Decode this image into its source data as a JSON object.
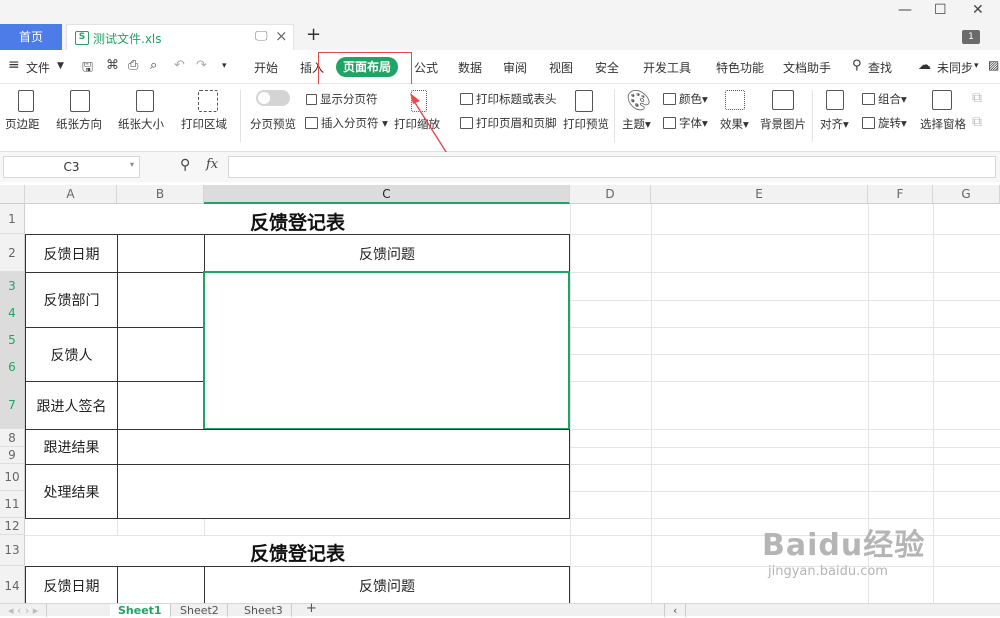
{
  "tabs": {
    "home": "首页",
    "file": "测试文件.xls",
    "new": "+"
  },
  "window": {
    "minimize": "—",
    "maximize": "☐",
    "close": "✕",
    "badge": "1"
  },
  "menu": {
    "file": "文件",
    "items": [
      "开始",
      "插入",
      "页面布局",
      "公式",
      "数据",
      "审阅",
      "视图",
      "安全",
      "开发工具",
      "特色功能",
      "文档助手"
    ],
    "active": "页面布局",
    "search": "查找",
    "sync": "未同步"
  },
  "ribbon": {
    "margins": "页边距",
    "orientation": "纸张方向",
    "size": "纸张大小",
    "print_area": "打印区域",
    "page_preview": "分页预览",
    "show_breaks": "显示分页符",
    "insert_break": "插入分页符",
    "print_scale": "打印缩放",
    "print_titles": "打印标题或表头",
    "header_footer": "打印页眉和页脚",
    "print_preview": "打印预览",
    "theme": "主题",
    "colors": "颜色",
    "fonts": "字体",
    "effects": "效果",
    "background": "背景图片",
    "align": "对齐",
    "group": "组合",
    "rotate": "旋转",
    "selection_pane": "选择窗格"
  },
  "formula": {
    "cell_ref": "C3",
    "fx": "fx",
    "value": ""
  },
  "columns": [
    "A",
    "B",
    "C",
    "D",
    "E",
    "F",
    "G"
  ],
  "rows": [
    "1",
    "2",
    "3",
    "4",
    "5",
    "6",
    "7",
    "8",
    "9",
    "10",
    "11",
    "12",
    "13",
    "14"
  ],
  "form": {
    "title": "反馈登记表",
    "feedback_date": "反馈日期",
    "feedback_issue": "反馈问题",
    "department": "反馈部门",
    "person": "反馈人",
    "follow_signer": "跟进人签名",
    "follow_result": "跟进结果",
    "handle_result": "处理结果"
  },
  "sheets": [
    "Sheet1",
    "Sheet2",
    "Sheet3"
  ],
  "watermark": {
    "brand": "Baidu经验",
    "url": "jingyan.baidu.com"
  },
  "colors": {
    "accent": "#1fa463",
    "home_tab": "#4d7ce8",
    "highlight": "#e84a4a"
  }
}
